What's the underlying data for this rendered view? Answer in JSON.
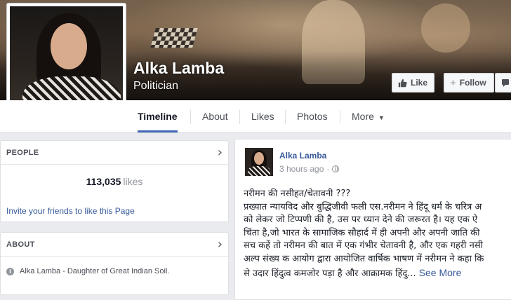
{
  "page": {
    "name": "Alka Lamba",
    "category": "Politician"
  },
  "header_buttons": {
    "like_label": "Like",
    "follow_label": "Follow"
  },
  "nav": {
    "tabs": [
      {
        "label": "Timeline",
        "active": true
      },
      {
        "label": "About"
      },
      {
        "label": "Likes"
      },
      {
        "label": "Photos"
      },
      {
        "label": "More",
        "icon": "caret-down-icon"
      }
    ]
  },
  "people_card": {
    "title": "PEOPLE",
    "likes_count": "113,035",
    "likes_word": "likes",
    "invite_text": "Invite your friends to like this Page"
  },
  "about_card": {
    "title": "ABOUT",
    "description": "Alka Lamba - Daughter of Great Indian Soil."
  },
  "post": {
    "author": "Alka Lamba",
    "time": "3 hours ago",
    "lines": [
      "नरीमन की नसीहत/चेतावनी ???",
      "प्रख्यात न्यायविद और बुद्धिजीवी फली एस.नरीमन ने हिंदू धर्म के चरित्र अ",
      "को लेकर जो टिप्पणी की है, उस पर ध्यान देने की जरूरत है। यह एक ऐ",
      "चिंता है,जो भारत के सामाजिक सौहार्द में ही अपनी और अपनी जाति की",
      "सच कहें तो नरीमन की बात में एक गंभीर चेतावनी है, और एक गहरी नसी",
      "अल्प संख्य क आयोग द्वारा आयोजित वार्षिक भाषण में नरीमन ने कहा कि",
      "से उदार हिंदुत्व कमजोर पड़ा है और आक्रामक हिंदु..."
    ],
    "see_more": "See More"
  },
  "colors": {
    "link": "#365899",
    "tab_underline": "#4267b2",
    "background": "#e9ebee"
  }
}
